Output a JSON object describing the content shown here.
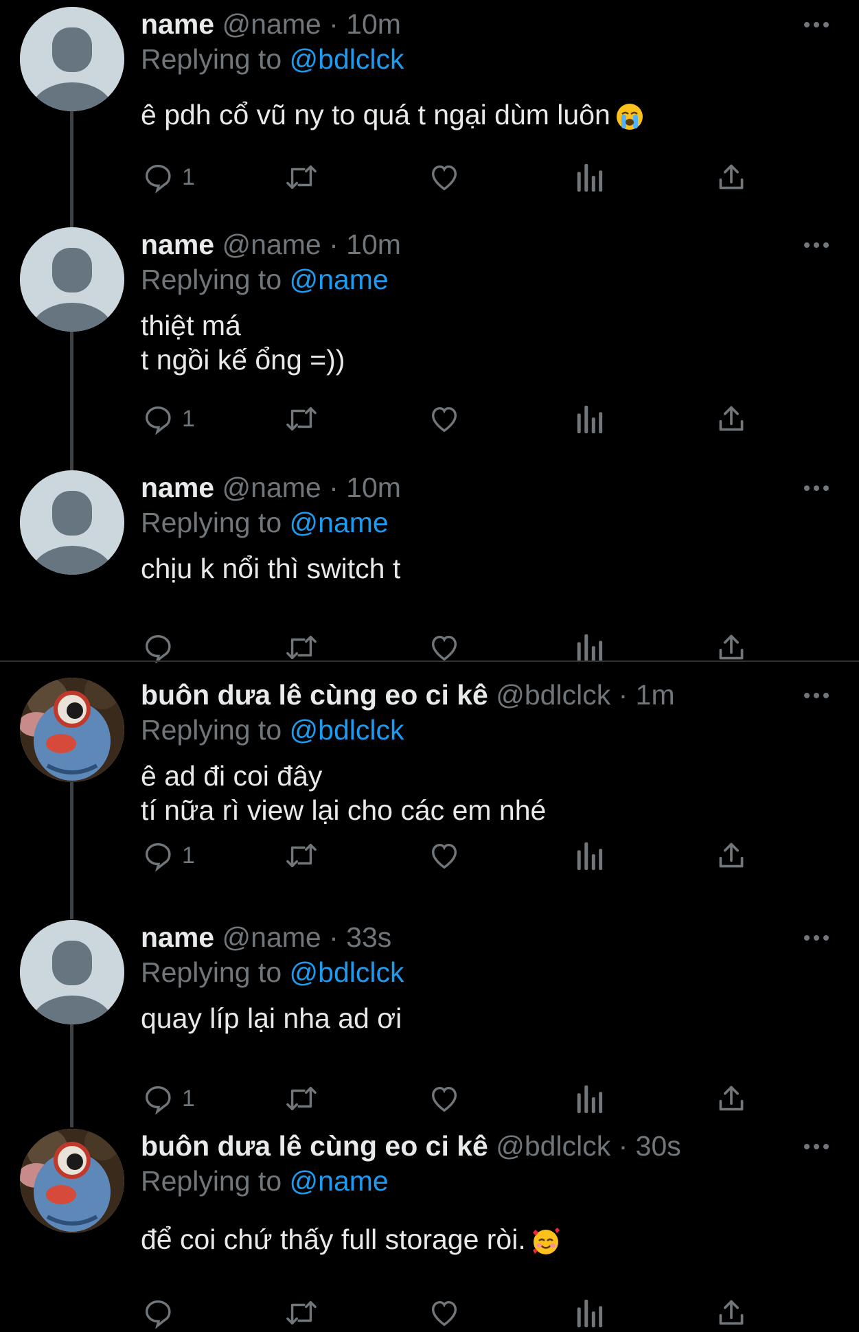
{
  "tweets": [
    {
      "name": "name",
      "handle": "@name",
      "sep": "·",
      "time": "10m",
      "replying_prefix": "Replying to ",
      "replying_to": "@bdlclck",
      "text": "ê pdh cổ vũ ny to quá t ngại dùm luôn",
      "emoji": "loudly-crying-face",
      "reply_count": "1",
      "avatar": "default"
    },
    {
      "name": "name",
      "handle": "@name",
      "sep": "·",
      "time": "10m",
      "replying_prefix": "Replying to ",
      "replying_to": "@name",
      "text": "thiệt má\nt ngồi kế ổng =))",
      "reply_count": "1",
      "avatar": "default"
    },
    {
      "name": "name",
      "handle": "@name",
      "sep": "·",
      "time": "10m",
      "replying_prefix": "Replying to ",
      "replying_to": "@name",
      "text": "chịu k nổi thì switch t",
      "reply_count": "",
      "avatar": "default"
    },
    {
      "name": "buôn dưa lê cùng eo ci kê",
      "handle": "@bdlclck",
      "sep": "·",
      "time": "1m",
      "replying_prefix": "Replying to ",
      "replying_to": "@bdlclck",
      "text": "ê ad đi coi đây\ntí nữa rì view lại cho các em nhé",
      "reply_count": "1",
      "avatar": "cartoon"
    },
    {
      "name": "name",
      "handle": "@name",
      "sep": "·",
      "time": "33s",
      "replying_prefix": "Replying to ",
      "replying_to": "@bdlclck",
      "text": "quay líp lại nha ad ơi",
      "reply_count": "1",
      "avatar": "default"
    },
    {
      "name": "buôn dưa lê cùng eo ci kê",
      "handle": "@bdlclck",
      "sep": "·",
      "time": "30s",
      "replying_prefix": "Replying to ",
      "replying_to": "@name",
      "text": "để coi chứ thấy full storage ròi.",
      "emoji": "smiling-face-with-hearts",
      "reply_count": "",
      "avatar": "cartoon"
    }
  ],
  "colors": {
    "background": "#000000",
    "text": "#e7e9ea",
    "secondary": "#71767b",
    "link": "#1d9bf0",
    "thread_line": "#3e4144"
  }
}
